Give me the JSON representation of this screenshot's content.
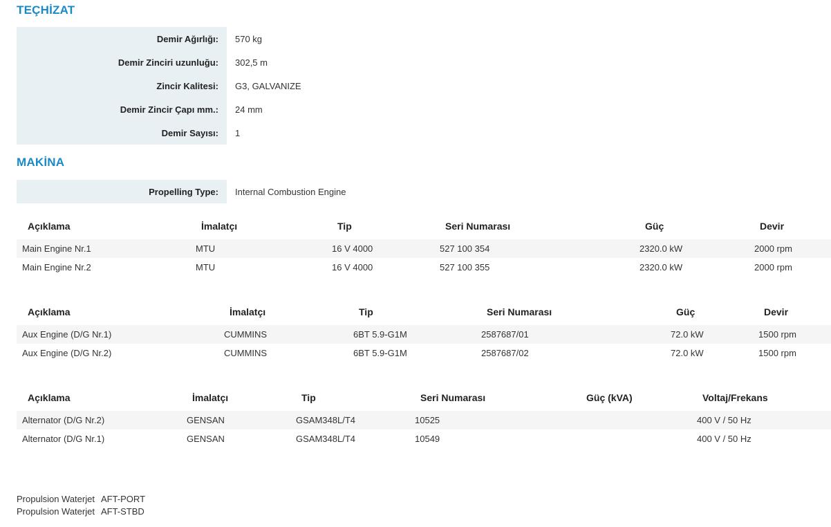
{
  "equipment": {
    "title": "TEÇHİZAT",
    "rows": [
      {
        "label": "Demir Ağırlığı:",
        "value": "570 kg"
      },
      {
        "label": "Demir Zinciri uzunluğu:",
        "value": "302,5 m"
      },
      {
        "label": "Zincir Kalitesi:",
        "value": "G3, GALVANIZE"
      },
      {
        "label": "Demir Zincir Çapı mm.:",
        "value": "24 mm"
      },
      {
        "label": "Demir Sayısı:",
        "value": "1"
      }
    ]
  },
  "machinery": {
    "title": "MAKİNA",
    "propelling": {
      "label": "Propelling Type:",
      "value": "Internal Combustion Engine"
    }
  },
  "main_engines": {
    "headers": [
      "Açıklama",
      "İmalatçı",
      "Tip",
      "Seri Numarası",
      "Güç",
      "Devir"
    ],
    "rows": [
      [
        "Main Engine Nr.1",
        "MTU",
        "16 V 4000",
        "527 100 354",
        "2320.0 kW",
        "2000 rpm"
      ],
      [
        "Main Engine Nr.2",
        "MTU",
        "16 V 4000",
        "527 100 355",
        "2320.0 kW",
        "2000 rpm"
      ]
    ]
  },
  "aux_engines": {
    "headers": [
      "Açıklama",
      "İmalatçı",
      "Tip",
      "Seri Numarası",
      "Güç",
      "Devir"
    ],
    "rows": [
      [
        "Aux Engine (D/G Nr.1)",
        "CUMMINS",
        "6BT 5.9-G1M",
        "2587687/01",
        "72.0 kW",
        "1500 rpm"
      ],
      [
        "Aux Engine (D/G Nr.2)",
        "CUMMINS",
        "6BT 5.9-G1M",
        "2587687/02",
        "72.0 kW",
        "1500 rpm"
      ]
    ]
  },
  "alternators": {
    "headers": [
      "Açıklama",
      "İmalatçı",
      "Tip",
      "Seri Numarası",
      "Güç (kVA)",
      "Voltaj/Frekans"
    ],
    "rows": [
      [
        "Alternator (D/G Nr.2)",
        "GENSAN",
        "GSAM348L/T4",
        "10525",
        "",
        "400 V / 50 Hz"
      ],
      [
        "Alternator (D/G Nr.1)",
        "GENSAN",
        "GSAM348L/T4",
        "10549",
        "",
        "400 V / 50 Hz"
      ]
    ]
  },
  "propulsion": [
    {
      "name": "Propulsion Waterjet",
      "position": "AFT-PORT"
    },
    {
      "name": "Propulsion Waterjet",
      "position": "AFT-STBD"
    }
  ]
}
